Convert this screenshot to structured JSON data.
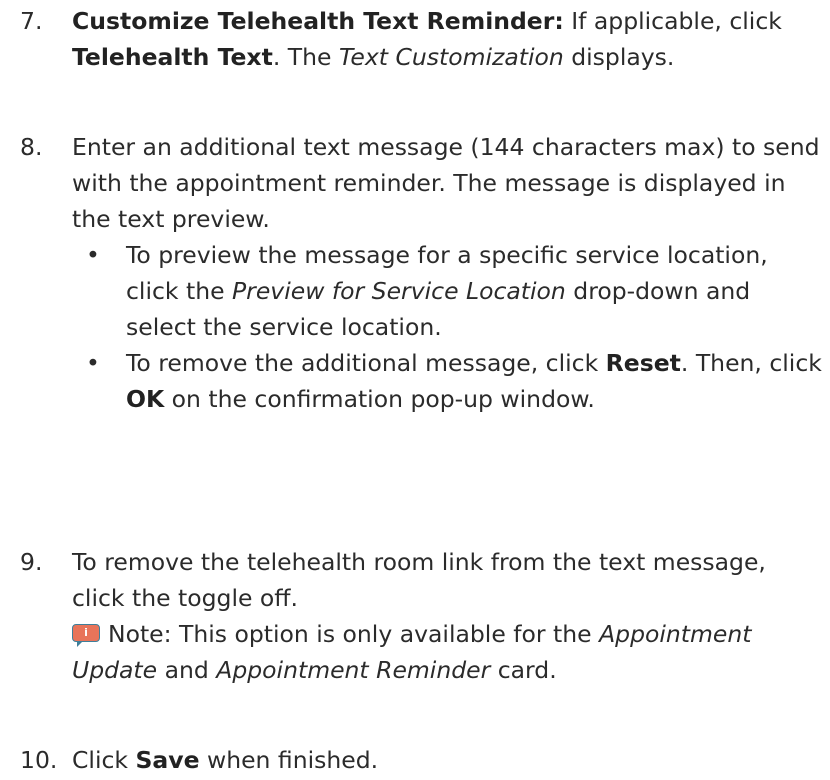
{
  "steps": {
    "s7": {
      "number": "7.",
      "bold_title": "Customize Telehealth Text Reminder:",
      "t1": " If applicable, click ",
      "bold_button": "Telehealth Text",
      "t2": ". The ",
      "italic_screen": "Text Customization",
      "t3": " displays."
    },
    "s8": {
      "number": "8.",
      "text": "Enter an additional text message (144 characters max) to send with the appointment reminder. The message is displayed in the text preview.",
      "bullets": [
        {
          "t1": "To preview the message for a specific service location, click the ",
          "italic": "Preview for Service Location",
          "t2": " drop-down and select the service location."
        },
        {
          "t1": "To remove the additional message, click ",
          "bold1": "Reset",
          "t2": ". Then, click ",
          "bold2": "OK",
          "t3": " on the confirmation pop-up window."
        }
      ]
    },
    "s9": {
      "number": "9.",
      "text": "To remove the telehealth room link from the text message, click the toggle off.",
      "note_icon": "info-note-icon",
      "note_t1": "Note: This option is only available for the ",
      "note_i1": "Appointment Update",
      "note_t2": " and ",
      "note_i2": "Appointment Reminder",
      "note_t3": " card."
    },
    "s10": {
      "number": "10.",
      "t1": "Click ",
      "bold": "Save",
      "t2": " when finished."
    }
  },
  "bullet_glyph": "•",
  "colors": {
    "text": "#2b2b2b",
    "note_icon_fill": "#e8745a",
    "note_icon_border": "#3f7f9a"
  }
}
